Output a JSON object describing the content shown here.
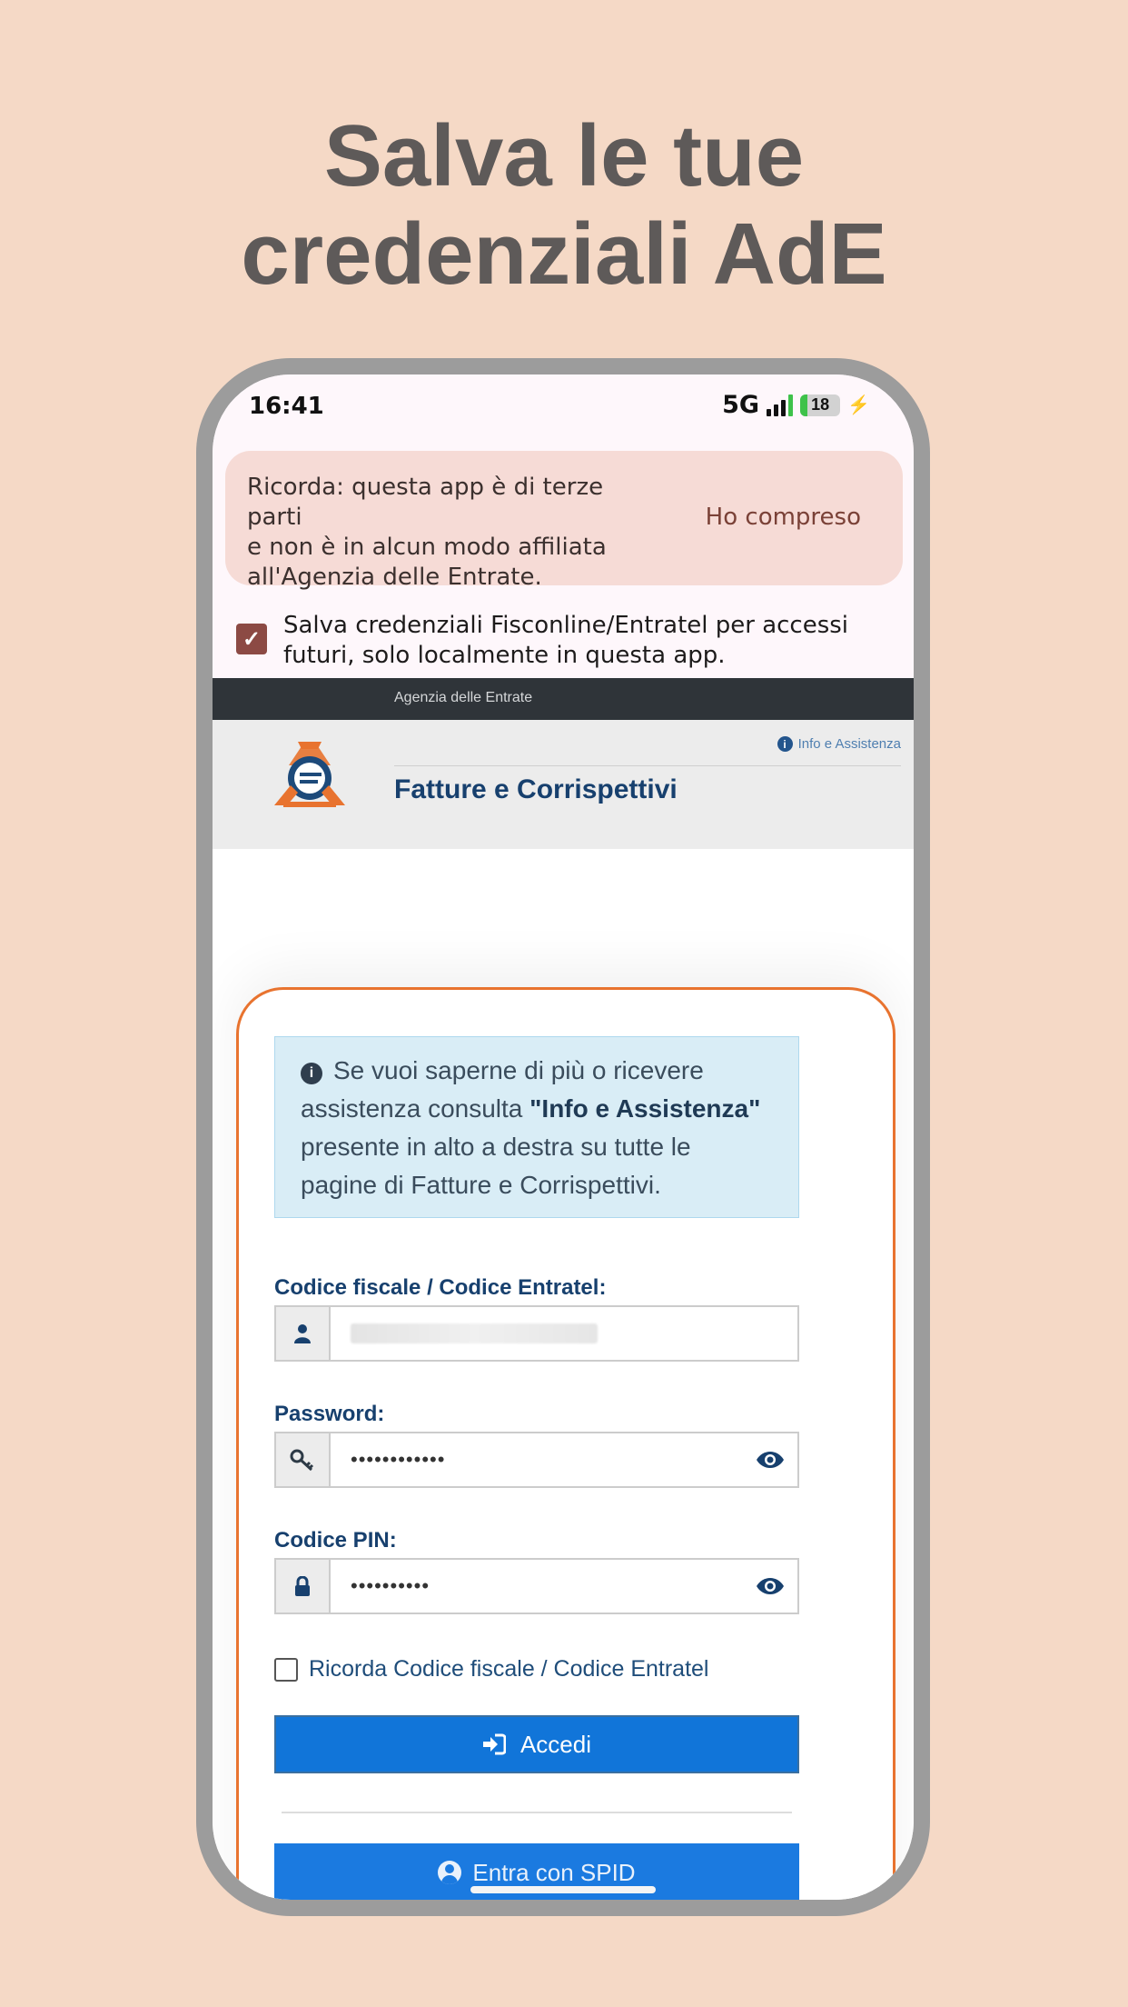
{
  "headline": {
    "line1": "Salva le tue",
    "line2": "credenziali AdE"
  },
  "status_bar": {
    "time": "16:41",
    "network": "5G",
    "battery": "18"
  },
  "notice": {
    "text": "Ricorda: questa app è di terze parti\ne non è in alcun modo affiliata\nall'Agenzia delle Entrate.",
    "button": "Ho compreso"
  },
  "save_credentials": {
    "checked": true,
    "text": "Salva credenziali Fisconline/Entratel per accessi\nfuturi, solo localmente in questa app."
  },
  "ade": {
    "topbar": "Agenzia delle Entrate",
    "info_link": "Info e Assistenza",
    "title": "Fatture e Corrispettivi"
  },
  "info_box": {
    "before": "Se vuoi saperne di più o ricevere assistenza consulta ",
    "bold": "\"Info e Assistenza\"",
    "after": " presente in alto a destra su tutte le pagine di Fatture e Corrispettivi."
  },
  "form": {
    "codice_label": "Codice fiscale / Codice Entratel:",
    "password_label": "Password:",
    "password_value": "••••••••••••",
    "pin_label": "Codice PIN:",
    "pin_value": "••••••••••",
    "remember_label": "Ricorda Codice fiscale / Codice Entratel",
    "login_button": "Accedi",
    "spid_button": "Entra con SPID"
  },
  "colors": {
    "background": "#f5d9c6",
    "accent_orange": "#e8732f",
    "primary_blue": "#1175d9",
    "label_blue": "#17406e",
    "notice_bg": "#f6dbd6"
  }
}
